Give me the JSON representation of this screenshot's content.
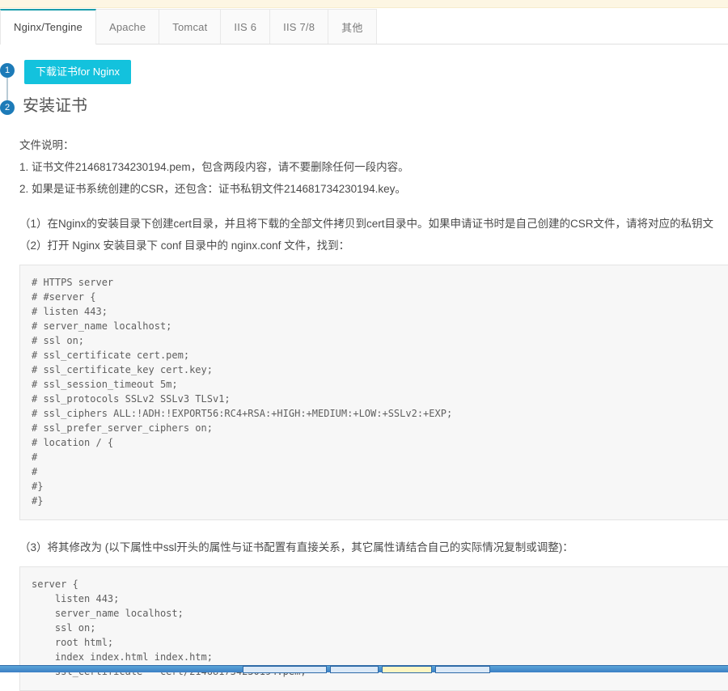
{
  "tabs": [
    {
      "label": "Nginx/Tengine",
      "active": true
    },
    {
      "label": "Apache",
      "active": false
    },
    {
      "label": "Tomcat",
      "active": false
    },
    {
      "label": "IIS 6",
      "active": false
    },
    {
      "label": "IIS 7/8",
      "active": false
    },
    {
      "label": "其他",
      "active": false
    }
  ],
  "steps": {
    "one": "1",
    "two": "2",
    "download_button": "下载证书for Nginx",
    "install_title": "安装证书"
  },
  "content": {
    "file_desc_heading": "文件说明：",
    "item1": "1. 证书文件214681734230194.pem，包含两段内容，请不要删除任何一段内容。",
    "item2": "2. 如果是证书系统创建的CSR，还包含：证书私钥文件214681734230194.key。",
    "step1": "（1）在Nginx的安装目录下创建cert目录，并且将下载的全部文件拷贝到cert目录中。如果申请证书时是自己创建的CSR文件，请将对应的私钥文",
    "step2": "（2）打开 Nginx 安装目录下 conf 目录中的 nginx.conf 文件，找到：",
    "step3": "（3）将其修改为 (以下属性中ssl开头的属性与证书配置有直接关系，其它属性请结合自己的实际情况复制或调整)："
  },
  "code_blocks": {
    "original": "# HTTPS server\n# #server {\n# listen 443;\n# server_name localhost;\n# ssl on;\n# ssl_certificate cert.pem;\n# ssl_certificate_key cert.key;\n# ssl_session_timeout 5m;\n# ssl_protocols SSLv2 SSLv3 TLSv1;\n# ssl_ciphers ALL:!ADH:!EXPORT56:RC4+RSA:+HIGH:+MEDIUM:+LOW:+SSLv2:+EXP;\n# ssl_prefer_server_ciphers on;\n# location / {\n#\n#\n#}\n#}",
    "modified": "server {\n    listen 443;\n    server_name localhost;\n    ssl on;\n    root html;\n    index index.html index.htm;\n    ssl_certificate   cert/214681734230194.pem;"
  },
  "colors": {
    "accent_teal": "#1b9dab",
    "button_cyan": "#13c2dd",
    "step_blue": "#1d7bb8",
    "notice_yellow": "#fdf6e3"
  }
}
